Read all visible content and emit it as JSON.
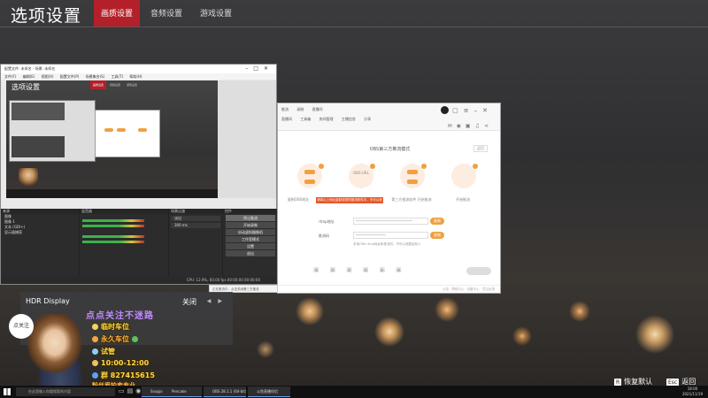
{
  "header": {
    "title": "选项设置",
    "tabs": [
      "画质设置",
      "音频设置",
      "游戏设置"
    ]
  },
  "obs": {
    "window_title": "配置文件: 未命名 - 场景: 未命名",
    "menu": [
      "文件(F)",
      "编辑(E)",
      "视图(V)",
      "配置文件(P)",
      "场景集合(S)",
      "工具(T)",
      "帮助(H)"
    ],
    "preview_title": "选项设置",
    "preview_tabs": [
      "画质设置",
      "音频设置",
      "游戏设置"
    ],
    "panels": {
      "scenes_label": "来源",
      "mixer_label": "混音器",
      "transitions_label": "场景过渡",
      "controls_label": "控件"
    },
    "sources": [
      "图像",
      "图像 1",
      "文本 (GDI+)",
      "显示器捕获"
    ],
    "transition_value": "淡出",
    "transition_duration": "300 ms",
    "controls": [
      "停止推流",
      "开始录制",
      "启动虚拟摄像机",
      "工作室模式",
      "设置",
      "退出"
    ],
    "status": "CPU: 12.9%, 60.00 fps   00:00:00   00:00:00"
  },
  "app2": {
    "tabs_row1": [
      "推流",
      "录制",
      "直播间"
    ],
    "tabs_row2": [
      "直播间",
      "工具箱",
      "房间管理",
      "主播信息",
      "分享"
    ],
    "heading": "OBS第三方推流模式",
    "next_label": "返回",
    "steps": [
      {
        "label": "复制OBS地址",
        "btn": "复制"
      },
      {
        "label": "OBS-URL",
        "btn": "复制"
      },
      {
        "label": "第三方推流软件 开始推流",
        "btn": "复制"
      },
      {
        "label": "开始推流",
        "btn": ""
      }
    ],
    "notice": "请将以上地址复制到您的推流软件中，不可以泄露给他人",
    "fields": [
      {
        "label": "rtmp地址",
        "value": "********************************",
        "btn": "复制"
      },
      {
        "label": "推流码",
        "value": "*****************",
        "btn": "复制"
      }
    ],
    "hint": "本地OBS rtmp地址和推流码，不可以泄露给他人",
    "footer": "公告 · 帮助中心 · 设置中心 · 意见反馈",
    "bottom_left": "正在推流中，点击关闭第三方推流"
  },
  "hdr": {
    "title": "HDR Display",
    "option": "关闭"
  },
  "overlay": {
    "bubble": "点关注",
    "promo": "点点关注不迷路",
    "lines": [
      {
        "text": "临时车位",
        "color": "#ffd84a"
      },
      {
        "text": "永久车位",
        "color": "#ffb24a"
      },
      {
        "text": "试管",
        "color": "#ffd84a"
      },
      {
        "text": "10:00-12:00",
        "color": "#ffd84a"
      },
      {
        "text": "群 827415615",
        "color": "#ffd84a"
      },
      {
        "text": "粉丝爱拍卖专业",
        "color": "#ffb24a"
      }
    ]
  },
  "bottom_buttons": {
    "restore_key": "R",
    "restore_label": "恢复默认",
    "esc_key": "Esc",
    "esc_label": "返回"
  },
  "taskbar": {
    "search_placeholder": "在这里输入你要搜索的内容",
    "apps": [
      "Snapjolt 10 - 1080...",
      "Pencake",
      "OBS 28.1.1 (64-bit)...",
      "斗鱼直播伴侣"
    ],
    "time": "18:00",
    "date": "2021/11/19"
  },
  "colors": {
    "accent_red": "#b3202a",
    "orange": "#f0a040",
    "notice_red": "#e4582a"
  }
}
